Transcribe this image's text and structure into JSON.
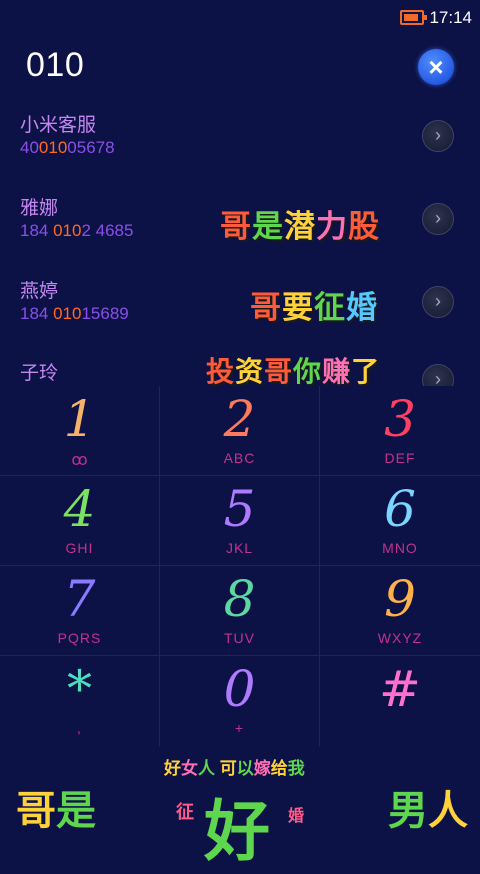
{
  "status_bar": {
    "time": "17:14"
  },
  "dial_input": {
    "value": "010"
  },
  "contacts": [
    {
      "name": "小米客服",
      "num_pre": "40",
      "num_hl": "010",
      "num_post": "05678"
    },
    {
      "name": "雅娜",
      "num_pre": "184 ",
      "num_hl": "010",
      "num_post": "2 4685"
    },
    {
      "name": "燕婷",
      "num_pre": "184 ",
      "num_hl": "010",
      "num_post": "15689"
    },
    {
      "name": "子玲",
      "num_pre": "",
      "num_hl": "",
      "num_post": ""
    }
  ],
  "slogans": {
    "row2": [
      "哥",
      "是",
      "潜",
      "力",
      "股"
    ],
    "row3": [
      "哥",
      "要",
      "征",
      "婚"
    ],
    "row4": [
      "投",
      "资",
      "哥",
      "你",
      "赚",
      "了"
    ]
  },
  "keys": [
    {
      "digit": "1",
      "letters": "",
      "color": "#f7b26a"
    },
    {
      "digit": "2",
      "letters": "ABC",
      "color": "#ff7a5a"
    },
    {
      "digit": "3",
      "letters": "DEF",
      "color": "#ff4060"
    },
    {
      "digit": "4",
      "letters": "GHI",
      "color": "#7ce060"
    },
    {
      "digit": "5",
      "letters": "JKL",
      "color": "#b07aff"
    },
    {
      "digit": "6",
      "letters": "MNO",
      "color": "#7ad6ff"
    },
    {
      "digit": "7",
      "letters": "PQRS",
      "color": "#8a7aff"
    },
    {
      "digit": "8",
      "letters": "TUV",
      "color": "#5ed6a0"
    },
    {
      "digit": "9",
      "letters": "WXYZ",
      "color": "#ffb24a"
    },
    {
      "digit": "*",
      "letters": ",",
      "color": "#4ae0c0"
    },
    {
      "digit": "0",
      "letters": "+",
      "color": "#b07aff"
    },
    {
      "digit": "#",
      "letters": "",
      "color": "#ff6fd0"
    }
  ],
  "voicemail_icon": "voicemail-icon",
  "banner": {
    "left": [
      "哥",
      "是"
    ],
    "right": [
      "男",
      "人"
    ],
    "top": [
      "好",
      "女",
      "人",
      "可",
      "以",
      "嫁",
      "给",
      "我"
    ],
    "middle": "好",
    "small_left": "征",
    "small_right": "婚"
  }
}
